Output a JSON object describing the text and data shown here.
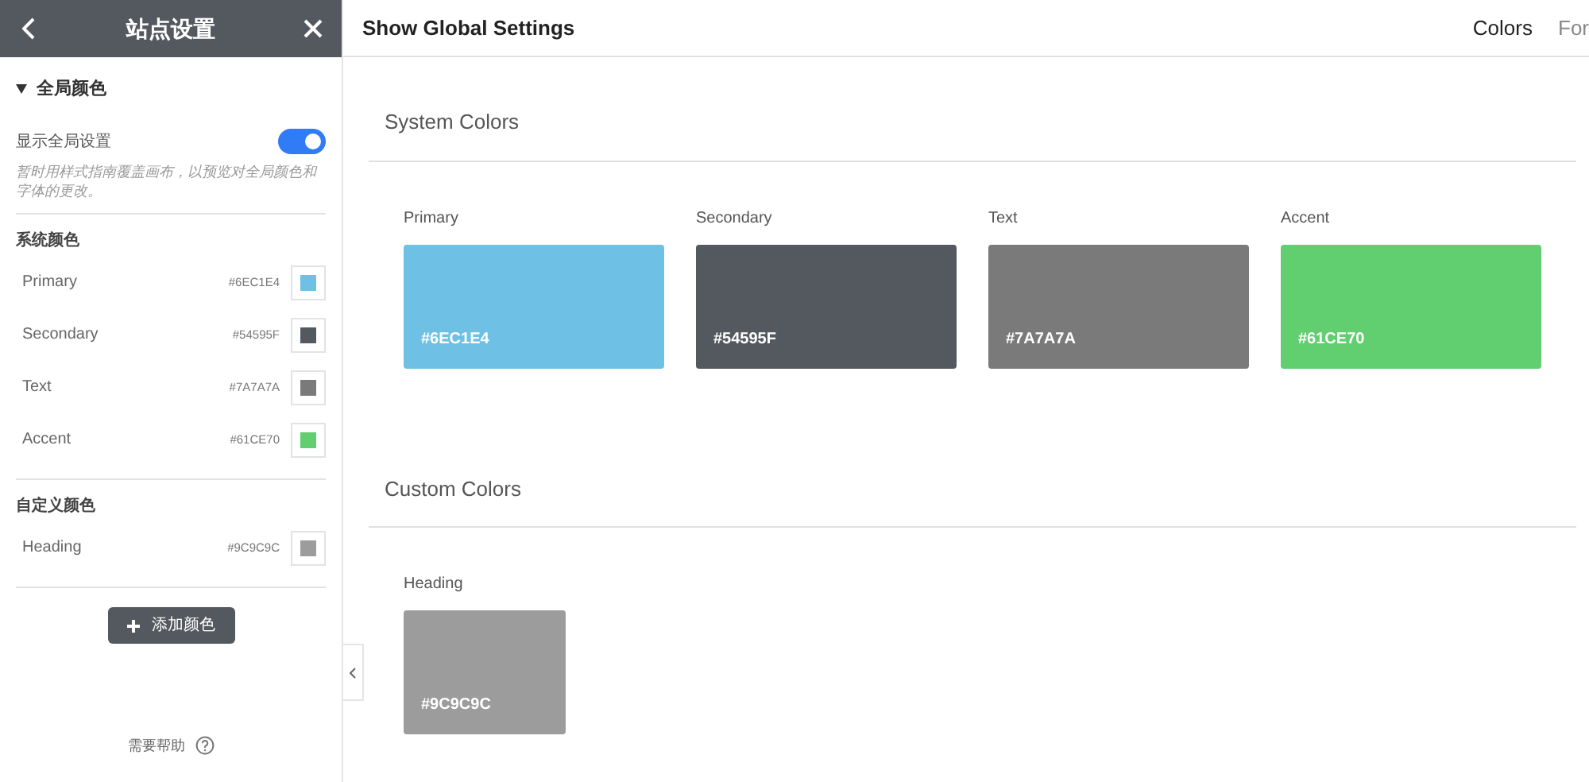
{
  "panel": {
    "title": "站点设置",
    "section": {
      "label": "全局颜色",
      "expanded": true
    },
    "toggle": {
      "label": "显示全局设置",
      "on": true
    },
    "hint": "暂时用样式指南覆盖画布，以预览对全局颜色和字体的更改。",
    "groups": [
      {
        "title": "系统颜色",
        "colors": [
          {
            "name": "Primary",
            "hex": "#6EC1E4",
            "color": "#6ec1e4"
          },
          {
            "name": "Secondary",
            "hex": "#54595F",
            "color": "#54595f"
          },
          {
            "name": "Text",
            "hex": "#7A7A7A",
            "color": "#7a7a7a"
          },
          {
            "name": "Accent",
            "hex": "#61CE70",
            "color": "#61ce70"
          }
        ]
      },
      {
        "title": "自定义颜色",
        "colors": [
          {
            "name": "Heading",
            "hex": "#9C9C9C",
            "color": "#9c9c9c"
          }
        ]
      }
    ],
    "add_button": "添加颜色",
    "help": "需要帮助"
  },
  "main": {
    "title": "Show Global Settings",
    "tabs": [
      {
        "label": "Colors",
        "selected": true
      },
      {
        "label": "For",
        "selected": false
      }
    ],
    "sections": [
      {
        "title": "System Colors",
        "colors": [
          {
            "name": "Primary",
            "hex": "#6EC1E4",
            "color": "#6ec1e4"
          },
          {
            "name": "Secondary",
            "hex": "#54595F",
            "color": "#54595f"
          },
          {
            "name": "Text",
            "hex": "#7A7A7A",
            "color": "#7a7a7a"
          },
          {
            "name": "Accent",
            "hex": "#61CE70",
            "color": "#61ce70"
          }
        ]
      },
      {
        "title": "Custom Colors",
        "colors": [
          {
            "name": "Heading",
            "hex": "#9C9C9C",
            "color": "#9c9c9c"
          }
        ]
      }
    ]
  }
}
